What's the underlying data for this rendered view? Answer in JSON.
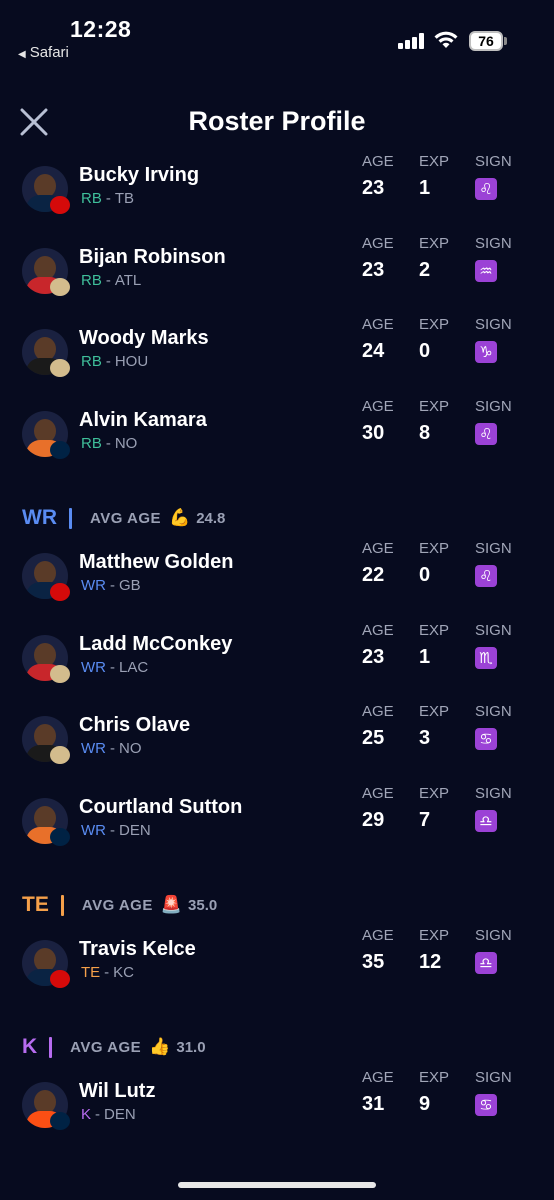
{
  "status_bar": {
    "time": "12:28",
    "back_app": "Safari",
    "battery": "76"
  },
  "header": {
    "title": "Roster Profile"
  },
  "labels": {
    "age": "AGE",
    "exp": "EXP",
    "sign": "SIGN"
  },
  "colors": {
    "background": "#070b1f",
    "rb": "#3fbf9a",
    "wr": "#5a8cf2",
    "te": "#f5a04a",
    "k": "#b76cf0",
    "sign_badge": "#9b42d6"
  },
  "rb_players": [
    {
      "name": "Bucky Irving",
      "pos": "RB",
      "team": "TB",
      "age": "23",
      "exp": "1",
      "sign": "♌",
      "sign_name": "leo-icon"
    },
    {
      "name": "Bijan Robinson",
      "pos": "RB",
      "team": "ATL",
      "age": "23",
      "exp": "2",
      "sign": "♒",
      "sign_name": "aquarius-icon"
    },
    {
      "name": "Woody Marks",
      "pos": "RB",
      "team": "HOU",
      "age": "24",
      "exp": "0",
      "sign": "♑",
      "sign_name": "capricorn-icon"
    },
    {
      "name": "Alvin Kamara",
      "pos": "RB",
      "team": "NO",
      "age": "30",
      "exp": "8",
      "sign": "♌",
      "sign_name": "leo-icon"
    }
  ],
  "wr_section": {
    "pos": "WR",
    "avg_label": "AVG AGE",
    "emoji": "💪",
    "avg": "24.8"
  },
  "wr_players": [
    {
      "name": "Matthew Golden",
      "pos": "WR",
      "team": "GB",
      "age": "22",
      "exp": "0",
      "sign": "♌",
      "sign_name": "leo-icon"
    },
    {
      "name": "Ladd McConkey",
      "pos": "WR",
      "team": "LAC",
      "age": "23",
      "exp": "1",
      "sign": "♏",
      "sign_name": "scorpio-icon"
    },
    {
      "name": "Chris Olave",
      "pos": "WR",
      "team": "NO",
      "age": "25",
      "exp": "3",
      "sign": "♋",
      "sign_name": "cancer-icon"
    },
    {
      "name": "Courtland Sutton",
      "pos": "WR",
      "team": "DEN",
      "age": "29",
      "exp": "7",
      "sign": "♎",
      "sign_name": "libra-icon"
    }
  ],
  "te_section": {
    "pos": "TE",
    "avg_label": "AVG AGE",
    "emoji": "🚨",
    "avg": "35.0"
  },
  "te_players": [
    {
      "name": "Travis Kelce",
      "pos": "TE",
      "team": "KC",
      "age": "35",
      "exp": "12",
      "sign": "♎",
      "sign_name": "libra-icon"
    }
  ],
  "k_section": {
    "pos": "K",
    "avg_label": "AVG AGE",
    "emoji": "👍",
    "avg": "31.0"
  },
  "k_players": [
    {
      "name": "Wil Lutz",
      "pos": "K",
      "team": "DEN",
      "age": "31",
      "exp": "9",
      "sign": "♋",
      "sign_name": "cancer-icon"
    }
  ]
}
